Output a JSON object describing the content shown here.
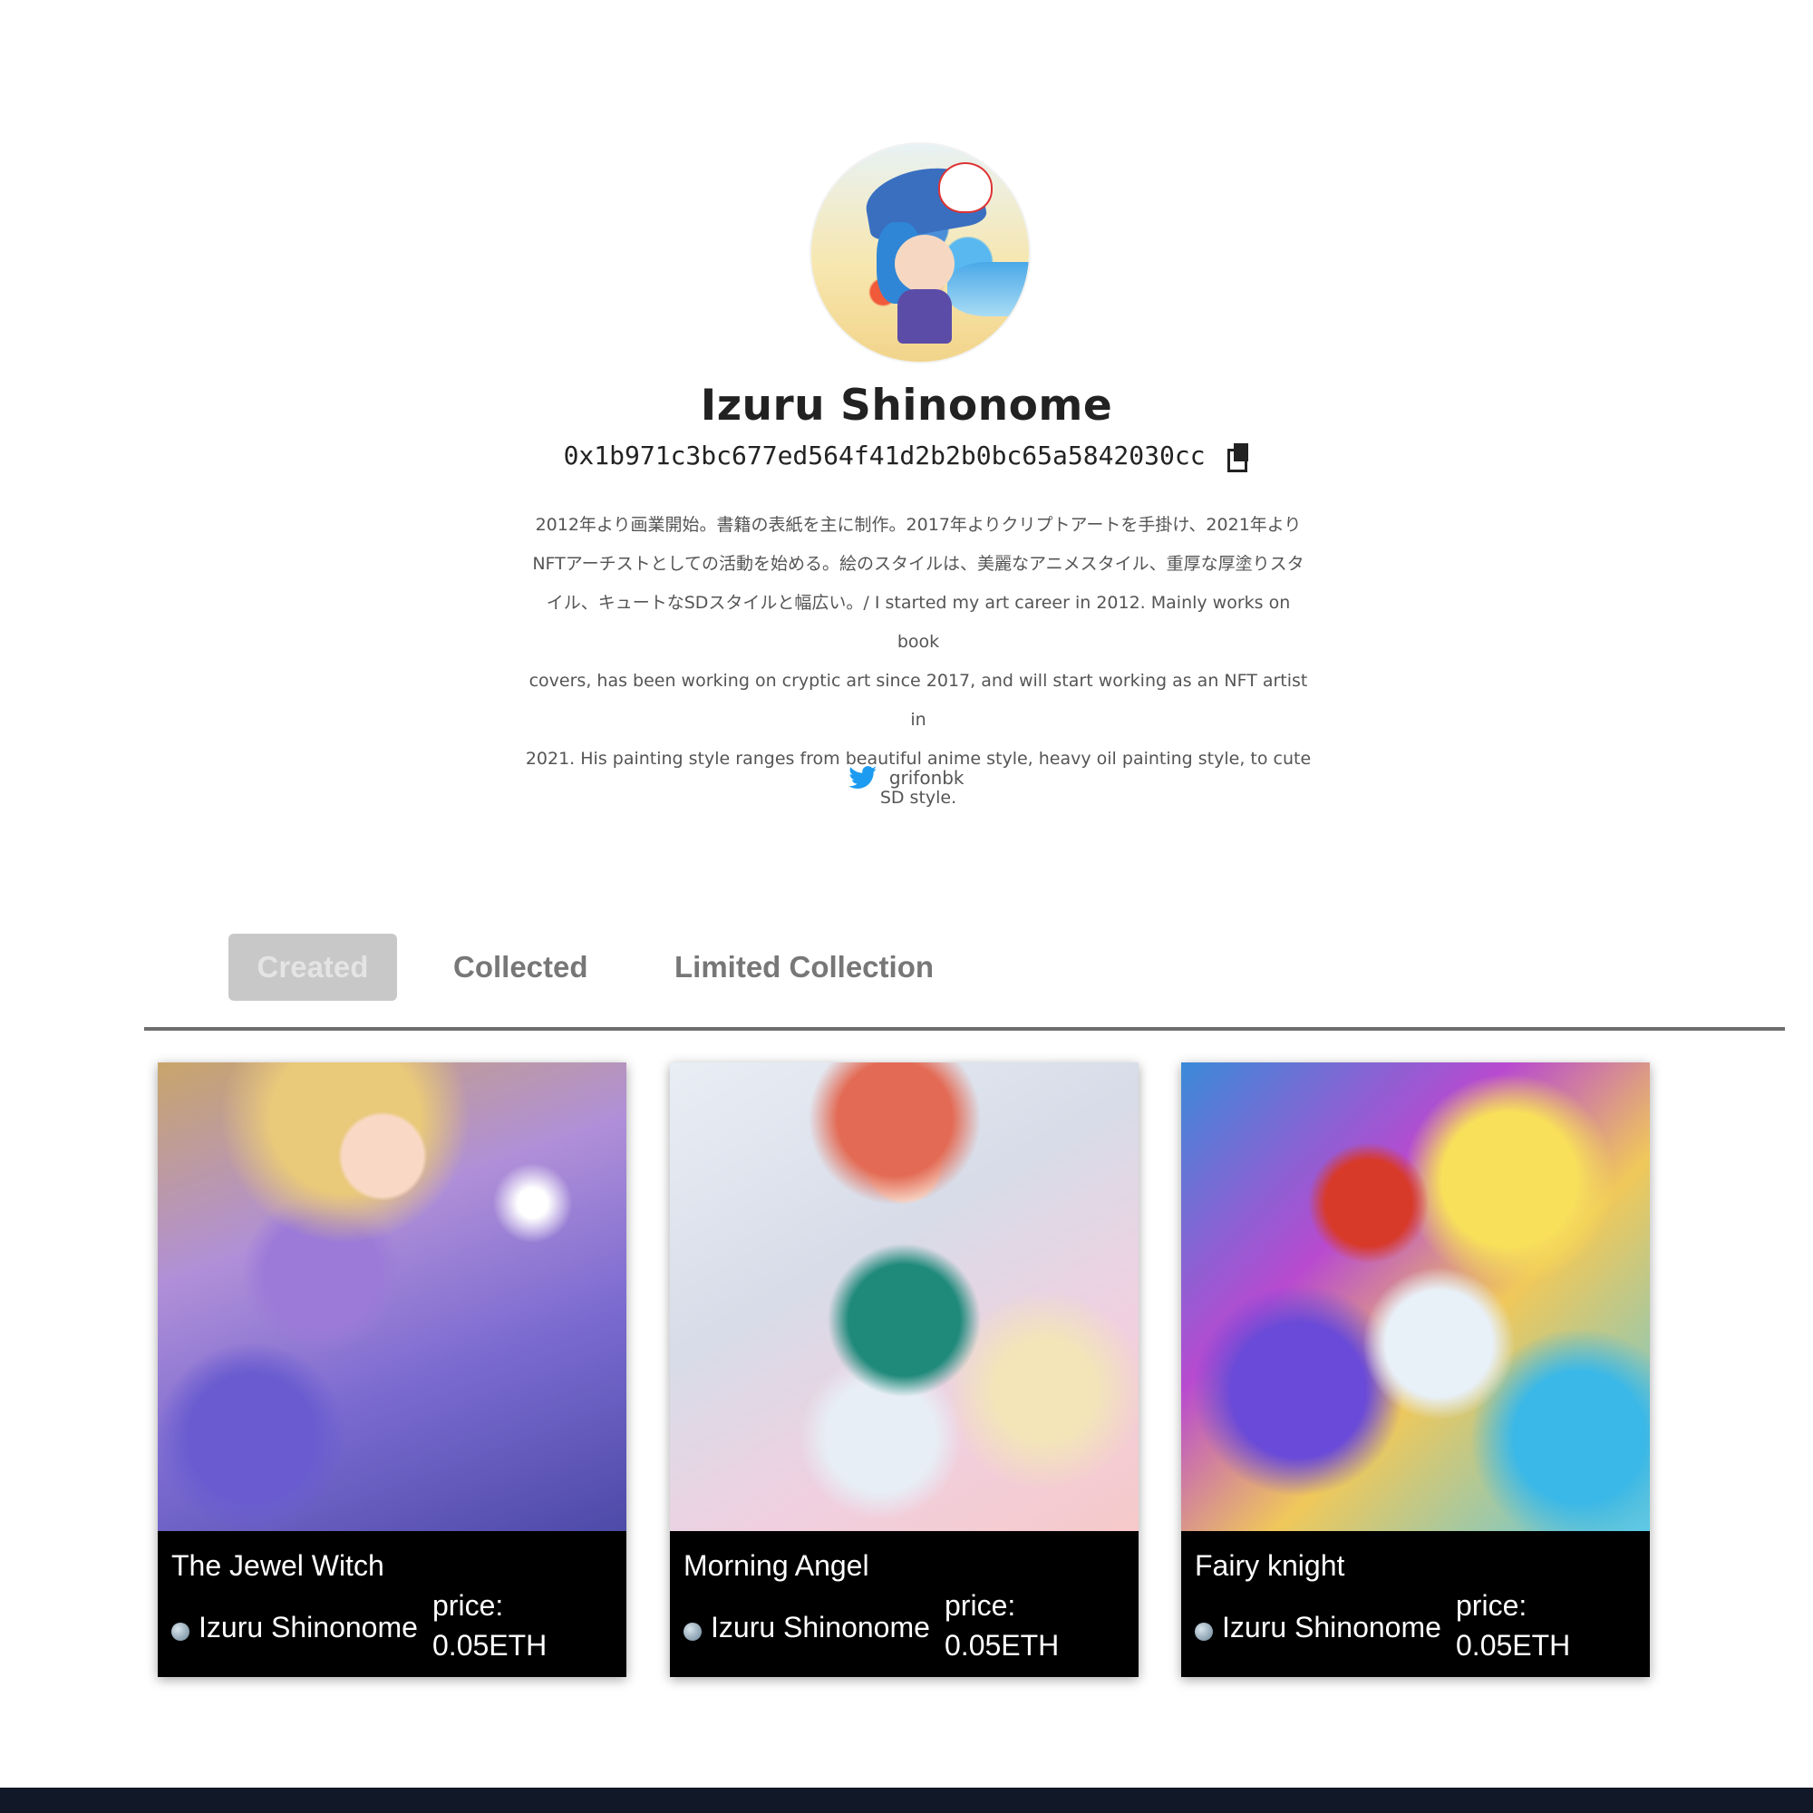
{
  "profile": {
    "name": "Izuru Shinonome",
    "address": "0x1b971c3bc677ed564f41d2b2b0bc65a5842030cc",
    "bio_lines": [
      "2012年より画業開始。書籍の表紙を主に制作。2017年よりクリプトアートを手掛け、2021年より",
      "NFTアーチストとしての活動を始める。絵のスタイルは、美麗なアニメスタイル、重厚な厚塗りスタ",
      "イル、キュートなSDスタイルと幅広い。/ I started my art career in 2012. Mainly works on book",
      "covers, has been working on cryptic art since 2017, and will start working as an NFT artist in",
      "2021. His painting style ranges from beautiful anime style, heavy oil painting style, to cute",
      "SD style."
    ],
    "twitter_handle": "grifonbk",
    "twitter_icon": "twitter-bird-icon",
    "avatar_icon": "avatar"
  },
  "tabs": [
    {
      "label": "Created",
      "active": true
    },
    {
      "label": "Collected",
      "active": false
    },
    {
      "label": "Limited Collection",
      "active": false
    }
  ],
  "cards": [
    {
      "title": "The Jewel Witch",
      "creator": "Izuru Shinonome",
      "price_label": "price:",
      "price_value": "0.05ETH"
    },
    {
      "title": "Morning Angel",
      "creator": "Izuru Shinonome",
      "price_label": "price:",
      "price_value": "0.05ETH"
    },
    {
      "title": "Fairy knight",
      "creator": "Izuru Shinonome",
      "price_label": "price:",
      "price_value": "0.05ETH"
    }
  ],
  "colors": {
    "accent_tab_bg": "#c8c8c8",
    "twitter_blue": "#1d9bf0",
    "card_info_bg": "#000000",
    "footer_bg": "#111827"
  }
}
